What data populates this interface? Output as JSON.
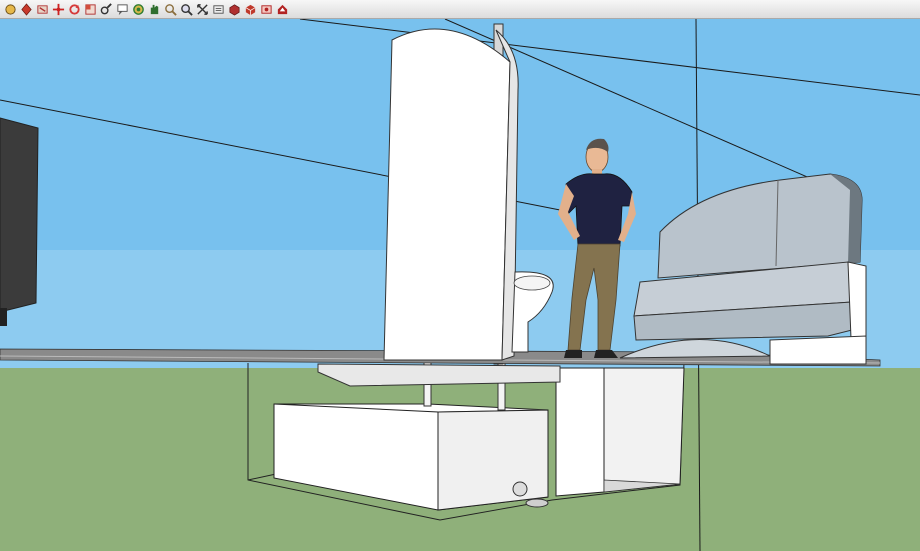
{
  "window": {
    "title": ""
  },
  "toolbar": {
    "tools": [
      {
        "name": "select",
        "color": "#3a6fb0"
      },
      {
        "name": "push-pull",
        "color": "#c8392b"
      },
      {
        "name": "move",
        "color": "#cc2222"
      },
      {
        "name": "paint-bucket",
        "color": "#c0392b"
      },
      {
        "name": "rotate",
        "color": "#d63a3a"
      },
      {
        "name": "scale",
        "color": "#d24d3b"
      },
      {
        "name": "zoom",
        "color": "#333333"
      },
      {
        "name": "zoom-window",
        "color": "#555555"
      },
      {
        "name": "orbit",
        "color": "#2f7d32"
      },
      {
        "name": "pan",
        "color": "#2f6f2f"
      },
      {
        "name": "look-around",
        "color": "#8a6d3b"
      },
      {
        "name": "zoom-extents",
        "color": "#333333"
      },
      {
        "name": "section-plane",
        "color": "#333333"
      },
      {
        "name": "components",
        "color": "#b03030"
      },
      {
        "name": "materials",
        "color": "#b03030"
      },
      {
        "name": "styles",
        "color": "#c0392b"
      },
      {
        "name": "warehouse",
        "color": "#b22222"
      }
    ]
  },
  "scene": {
    "sky_color": "#78c1ee",
    "ground_color": "#8fb07a"
  }
}
